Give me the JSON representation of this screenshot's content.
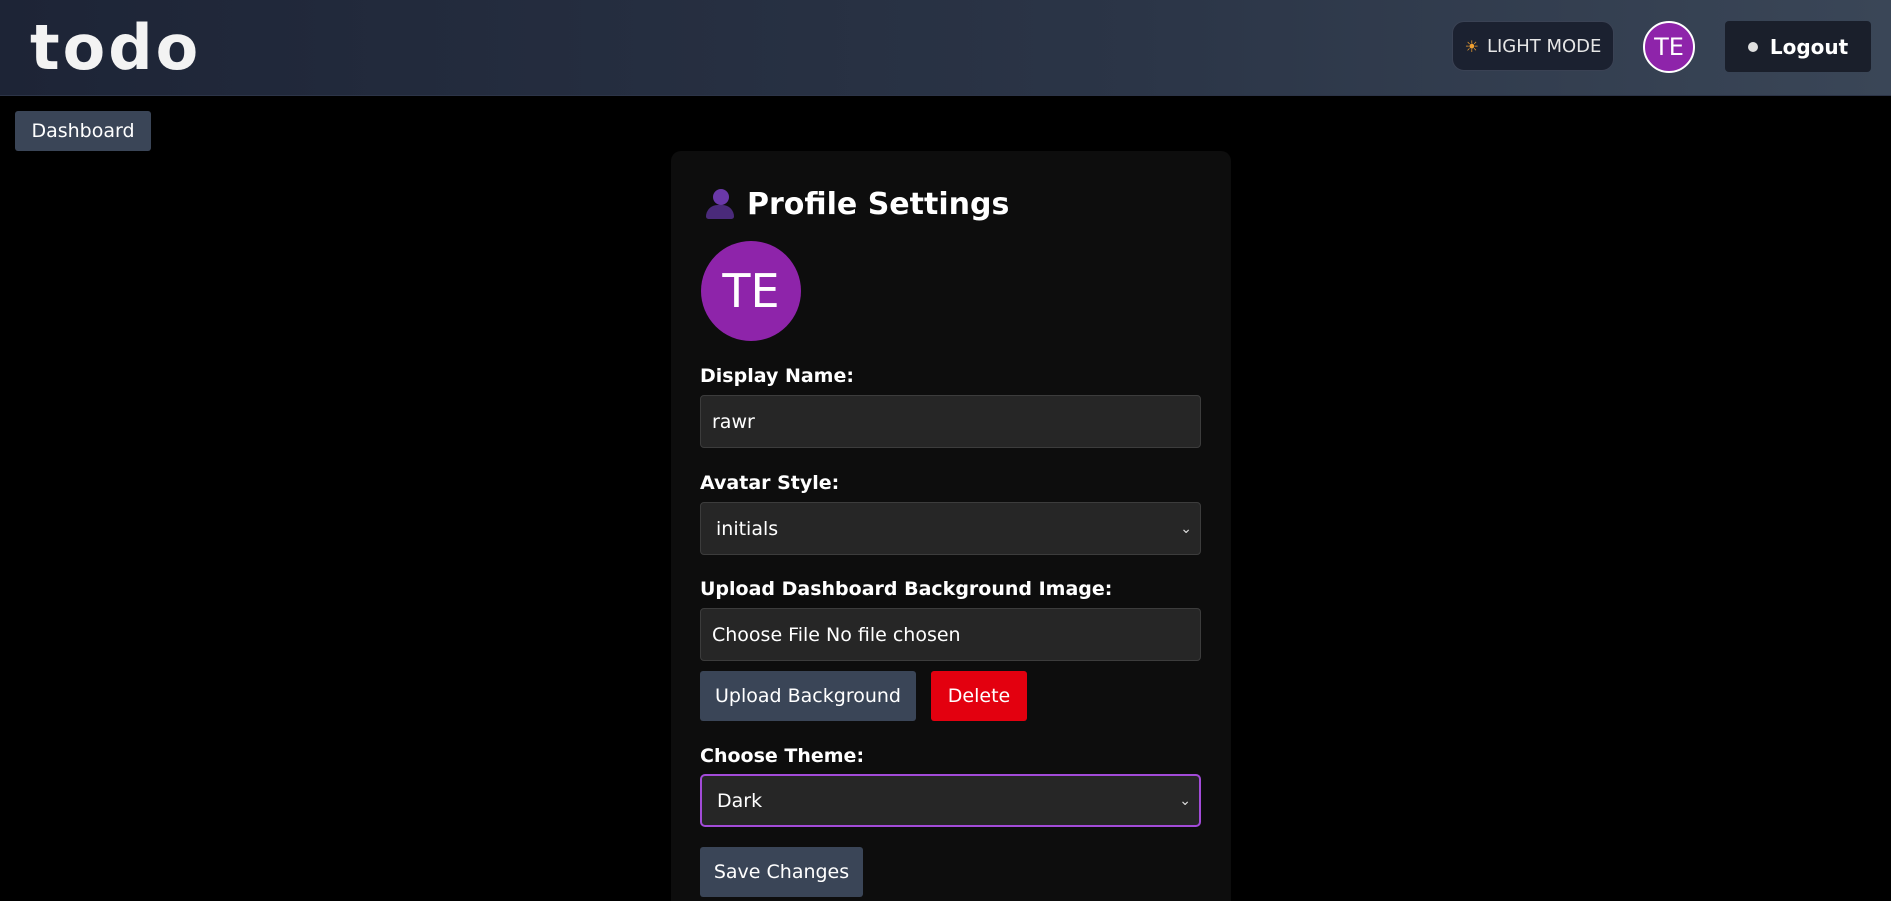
{
  "header": {
    "logo": "todo",
    "theme_toggle_label": "LIGHT MODE",
    "theme_toggle_icon": "sun-icon",
    "avatar_initials": "TE",
    "logout_label": "Logout"
  },
  "nav": {
    "dashboard_label": "Dashboard"
  },
  "profile": {
    "title": "Profile Settings",
    "title_icon": "user-icon",
    "avatar_initials": "TE",
    "avatar_color": "#8e24aa",
    "display_name": {
      "label": "Display Name:",
      "value": "rawr"
    },
    "avatar_style": {
      "label": "Avatar Style:",
      "selected": "initials"
    },
    "background": {
      "label": "Upload Dashboard Background Image:",
      "file_button": "Choose File",
      "file_status": "No file chosen",
      "upload_label": "Upload Background",
      "delete_label": "Delete"
    },
    "theme": {
      "label": "Choose Theme:",
      "selected": "Dark"
    },
    "save_label": "Save Changes"
  },
  "colors": {
    "accent": "#8e24aa",
    "danger": "#e3000f",
    "focus_ring": "#a24bd8",
    "button": "#3a4557"
  }
}
